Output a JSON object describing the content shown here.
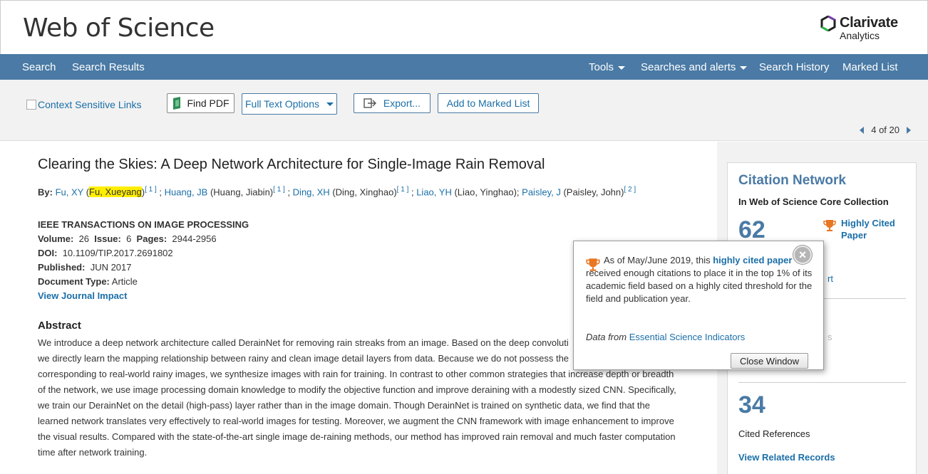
{
  "header": {
    "logo": "Web of Science",
    "brand_name": "Clarivate",
    "brand_sub": "Analytics"
  },
  "nav": {
    "left": [
      "Search",
      "Search Results"
    ],
    "tools": "Tools",
    "searches_alerts": "Searches and alerts",
    "search_history": "Search History",
    "marked_list": "Marked List"
  },
  "toolbar": {
    "context_links": "Context Sensitive Links",
    "find_pdf": "Find PDF",
    "full_text_options": "Full Text Options",
    "export": "Export...",
    "add_marked": "Add to Marked List",
    "pager_current": "4",
    "pager_of": "of",
    "pager_total": "20"
  },
  "record": {
    "title": "Clearing the Skies: A Deep Network Architecture for Single-Image Rain Removal",
    "by_label": "By:",
    "authors": [
      {
        "short": "Fu, XY",
        "full": "Fu, Xueyang",
        "ref": "[ 1 ]"
      },
      {
        "short": "Huang, JB",
        "full": "Huang, Jiabin",
        "ref": "[ 1 ]"
      },
      {
        "short": "Ding, XH",
        "full": "Ding, Xinghao",
        "ref": "[ 1 ]"
      },
      {
        "short": "Liao, YH",
        "full": "Liao, Yinghao",
        "ref": ""
      },
      {
        "short": "Paisley, J",
        "full": "Paisley, John",
        "ref": "[ 2 ]"
      }
    ],
    "journal": "IEEE TRANSACTIONS ON IMAGE PROCESSING",
    "volume_label": "Volume:",
    "volume": "26",
    "issue_label": "Issue:",
    "issue": "6",
    "pages_label": "Pages:",
    "pages": "2944-2956",
    "doi_label": "DOI:",
    "doi": "10.1109/TIP.2017.2691802",
    "published_label": "Published:",
    "published": "JUN 2017",
    "doctype_label": "Document Type:",
    "doctype": "Article",
    "journal_impact": "View Journal Impact",
    "abstract_heading": "Abstract",
    "abstract_lines": [
      "We introduce a deep network architecture called DerainNet for removing rain streaks from an image. Based on the deep convoluti",
      "we directly learn the mapping relationship between rainy and clean image detail layers from data. Because we do not possess the",
      "corresponding to real-world rainy images, we synthesize images with rain for training. In contrast to other common strategies that increase depth or breadth",
      "of the network, we use image processing domain knowledge to modify the objective function and improve deraining with a modestly sized CNN. Specifically,",
      "we train our DerainNet on the detail (high-pass) layer rather than in the image domain. Though DerainNet is trained on synthetic data, we find that the",
      "learned network translates very effectively to real-world images for testing. Moreover, we augment the CNN framework with image enhancement to improve",
      "the visual results. Compared with the state-of-the-art single image de-raining methods, our method has improved rain removal and much faster computation",
      "time after network training."
    ]
  },
  "citation": {
    "heading": "Citation Network",
    "sub": "In Web of Science Core Collection",
    "times_cited": "62",
    "highly_cited": "Highly Cited Paper",
    "partial_link": "rt",
    "partial_faint": "s",
    "cited_refs": "34",
    "cited_refs_label": "Cited References",
    "related": "View Related Records"
  },
  "popup": {
    "text_before": "As of May/June 2019, this",
    "link": "highly cited paper",
    "text_after": "received enough citations to place it in the top 1% of its academic field based on a highly cited threshold for the field and publication year.",
    "data_from": "Data from",
    "esi": "Essential Science Indicators",
    "close_window": "Close Window",
    "close_x": "×"
  },
  "colors": {
    "nav_bg": "#4a7aa5",
    "link": "#1b6fa8",
    "highlight": "#ffee00",
    "trophy": "#e87722"
  }
}
